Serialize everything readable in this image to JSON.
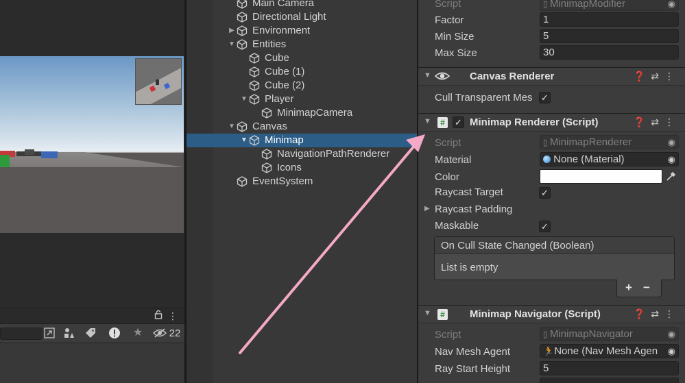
{
  "scene": {
    "toolbar_icons": [
      "lock-icon",
      "kebab-menu-icon"
    ],
    "search_icons": [
      "search-scene-icon",
      "prefab-filter-icon",
      "label-tag-icon",
      "error-icon",
      "favorite-star-icon",
      "hidden-eye-icon"
    ],
    "hidden_count": "22"
  },
  "hierarchy": {
    "items": [
      {
        "label": "Main Camera",
        "depth": 0,
        "expandable": false,
        "expanded": false
      },
      {
        "label": "Directional Light",
        "depth": 0,
        "expandable": false,
        "expanded": false
      },
      {
        "label": "Environment",
        "depth": 0,
        "expandable": true,
        "expanded": false
      },
      {
        "label": "Entities",
        "depth": 0,
        "expandable": true,
        "expanded": true
      },
      {
        "label": "Cube",
        "depth": 1,
        "expandable": false,
        "expanded": false
      },
      {
        "label": "Cube (1)",
        "depth": 1,
        "expandable": false,
        "expanded": false
      },
      {
        "label": "Cube (2)",
        "depth": 1,
        "expandable": false,
        "expanded": false
      },
      {
        "label": "Player",
        "depth": 1,
        "expandable": true,
        "expanded": true
      },
      {
        "label": "MinimapCamera",
        "depth": 2,
        "expandable": false,
        "expanded": false
      },
      {
        "label": "Canvas",
        "depth": 0,
        "expandable": true,
        "expanded": true
      },
      {
        "label": "Minimap",
        "depth": 1,
        "expandable": true,
        "expanded": true,
        "selected": true
      },
      {
        "label": "NavigationPathRenderer",
        "depth": 2,
        "expandable": false,
        "expanded": false
      },
      {
        "label": "Icons",
        "depth": 2,
        "expandable": false,
        "expanded": false
      },
      {
        "label": "EventSystem",
        "depth": 0,
        "expandable": false,
        "expanded": false
      }
    ]
  },
  "inspector": {
    "modifier": {
      "script_label": "Script",
      "script_value": "MinimapModifier",
      "factor_label": "Factor",
      "factor_value": "1",
      "min_size_label": "Min Size",
      "min_size_value": "5",
      "max_size_label": "Max Size",
      "max_size_value": "30"
    },
    "canvas_renderer": {
      "title": "Canvas Renderer",
      "cull_label": "Cull Transparent Mes",
      "cull_checked": true
    },
    "minimap_renderer": {
      "title": "Minimap Renderer (Script)",
      "enabled": true,
      "script_label": "Script",
      "script_value": "MinimapRenderer",
      "material_label": "Material",
      "material_value": "None (Material)",
      "color_label": "Color",
      "color_value": "#FFFFFF",
      "raycast_target_label": "Raycast Target",
      "raycast_target_checked": true,
      "raycast_padding_label": "Raycast Padding",
      "maskable_label": "Maskable",
      "maskable_checked": true,
      "event_title": "On Cull State Changed (Boolean)",
      "event_empty": "List is empty",
      "add_label": "+",
      "remove_label": "−"
    },
    "minimap_navigator": {
      "title": "Minimap Navigator (Script)",
      "script_label": "Script",
      "script_value": "MinimapNavigator",
      "agent_label": "Nav Mesh Agent",
      "agent_value": "None (Nav Mesh Agen",
      "ray_height_label": "Ray Start Height",
      "ray_height_value": "5"
    }
  },
  "colors": {
    "selection": "#2C5D87",
    "annotation_arrow": "#F4A9C7",
    "panel_bg": "#383838",
    "inspector_bg": "#3C3C3C"
  }
}
